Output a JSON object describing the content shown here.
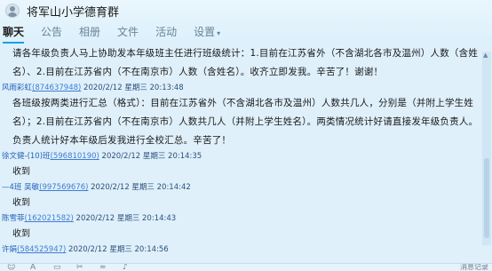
{
  "window": {
    "title": "将军山小学德育群"
  },
  "tabs": [
    {
      "label": "聊天"
    },
    {
      "label": "公告"
    },
    {
      "label": "相册"
    },
    {
      "label": "文件"
    },
    {
      "label": "活动"
    },
    {
      "label": "设置"
    }
  ],
  "messages": [
    {
      "text": "请各年级负责人马上协助发本年级班主任进行班级统计：1.目前在江苏省外（不含湖北各市及温州）人数（含姓名）、2.目前在江苏省内（不在南京市）人数（含姓名）。收齐立即发我。辛苦了！谢谢！"
    },
    {
      "sender": "风雨彩虹",
      "qq": "(874637948)",
      "time": "2020/2/12 星期三 20:13:48",
      "text": "各班级按两类进行汇总（格式）：目前在江苏省外（不含湖北各市及温州）人数共几人，分别是（并附上学生姓名）；2.目前在江苏省内（不在南京市）人数共几人（并附上学生姓名）。两类情况统计好请直接发年级负责人。负责人统计好本年级后发我进行全校汇总。辛苦了！"
    },
    {
      "sender": "徐文健-(10)班",
      "qq": "(596810190)",
      "time": "2020/2/12 星期三 20:14:35",
      "text": "收到"
    },
    {
      "sender": "—4班 吴敏",
      "qq": "(997569676)",
      "time": "2020/2/12 星期三 20:14:42",
      "text": "收到"
    },
    {
      "sender": "陈雪菲",
      "qq": "(162021582)",
      "time": "2020/2/12 星期三 20:14:43",
      "text": "收到"
    },
    {
      "sender": "许娟",
      "qq": "(584525947)",
      "time": "2020/2/12 星期三 20:14:56",
      "text": ""
    }
  ],
  "toolbar": {
    "icons": [
      "smile-icon",
      "font-icon",
      "image-icon",
      "scissors-icon",
      "shake-icon",
      "voice-icon"
    ],
    "label": "消息记录"
  }
}
